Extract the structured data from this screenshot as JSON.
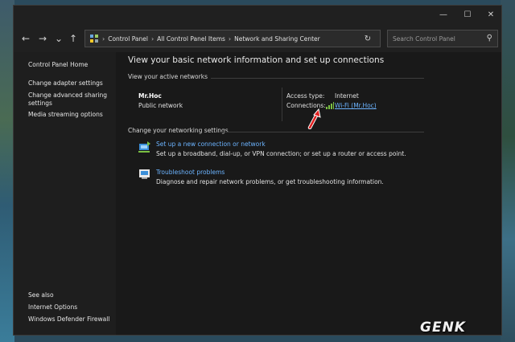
{
  "window_controls": {
    "minimize": "—",
    "maximize": "☐",
    "close": "✕"
  },
  "nav": {
    "back": "←",
    "forward": "→",
    "recent": "⌄",
    "up": "↑"
  },
  "breadcrumb": [
    "Control Panel",
    "All Control Panel Items",
    "Network and Sharing Center"
  ],
  "search": {
    "placeholder": "Search Control Panel"
  },
  "sidebar": {
    "home": "Control Panel Home",
    "items": [
      {
        "label": "Change adapter settings"
      },
      {
        "label": "Change advanced sharing settings"
      },
      {
        "label": "Media streaming options"
      }
    ],
    "see_also_title": "See also",
    "see_also": [
      {
        "label": "Internet Options"
      },
      {
        "label": "Windows Defender Firewall"
      }
    ]
  },
  "main": {
    "heading": "View your basic network information and set up connections",
    "active_networks_title": "View your active networks",
    "network": {
      "name": "Mr.Hoc",
      "type": "Public network",
      "access_type_label": "Access type:",
      "access_type_value": "Internet",
      "connections_label": "Connections:",
      "connection_link": "Wi-Fi (Mr.Hoc)"
    },
    "change_settings_title": "Change your networking settings",
    "tasks": [
      {
        "title": "Set up a new connection or network",
        "desc": "Set up a broadband, dial-up, or VPN connection; or set up a router or access point."
      },
      {
        "title": "Troubleshoot problems",
        "desc": "Diagnose and repair network problems, or get troubleshooting information."
      }
    ]
  },
  "watermark": "GENK",
  "colors": {
    "link": "#6cb4ff",
    "annotation_arrow": "#e02020",
    "background": "#191919"
  }
}
